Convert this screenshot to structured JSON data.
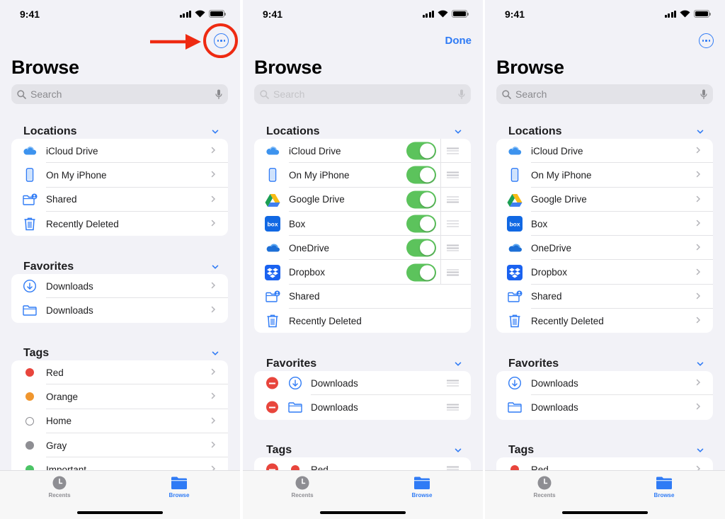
{
  "status": {
    "time": "9:41"
  },
  "colors": {
    "accent": "#2f7bf5",
    "toggle_on": "#5cc35c",
    "delete": "#e8453c",
    "annotation": "#ee2a12"
  },
  "panels": [
    {
      "top_action": {
        "type": "more",
        "icon": "ellipsis-circle-icon"
      },
      "title": "Browse",
      "search_placeholder": "Search",
      "sections": [
        {
          "label": "Locations",
          "rows": [
            {
              "label": "iCloud Drive",
              "icon": "icloud-icon"
            },
            {
              "label": "On My iPhone",
              "icon": "iphone-icon"
            },
            {
              "label": "Shared",
              "icon": "shared-folder-icon"
            },
            {
              "label": "Recently Deleted",
              "icon": "trash-icon"
            }
          ]
        },
        {
          "label": "Favorites",
          "rows": [
            {
              "label": "Downloads",
              "icon": "download-circle-icon"
            },
            {
              "label": "Downloads",
              "icon": "folder-icon"
            }
          ]
        },
        {
          "label": "Tags",
          "rows": [
            {
              "label": "Red",
              "color": "#e8453c"
            },
            {
              "label": "Orange",
              "color": "#f0962e"
            },
            {
              "label": "Home",
              "color": "#ffffff"
            },
            {
              "label": "Gray",
              "color": "#8e8e93"
            },
            {
              "label": "Important",
              "color": "#4cc466"
            }
          ]
        }
      ]
    },
    {
      "top_action": {
        "type": "done",
        "label": "Done"
      },
      "title": "Browse",
      "search_placeholder": "Search",
      "sections": [
        {
          "label": "Locations",
          "rows": [
            {
              "label": "iCloud Drive",
              "icon": "icloud-icon",
              "toggle": true
            },
            {
              "label": "On My iPhone",
              "icon": "iphone-icon",
              "toggle": true
            },
            {
              "label": "Google Drive",
              "icon": "google-drive-icon",
              "toggle": true
            },
            {
              "label": "Box",
              "icon": "box-icon",
              "toggle": true
            },
            {
              "label": "OneDrive",
              "icon": "onedrive-icon",
              "toggle": true
            },
            {
              "label": "Dropbox",
              "icon": "dropbox-icon",
              "toggle": true
            },
            {
              "label": "Shared",
              "icon": "shared-folder-icon"
            },
            {
              "label": "Recently Deleted",
              "icon": "trash-icon"
            }
          ]
        },
        {
          "label": "Favorites",
          "rows": [
            {
              "label": "Downloads",
              "icon": "download-circle-icon"
            },
            {
              "label": "Downloads",
              "icon": "folder-icon"
            }
          ]
        },
        {
          "label": "Tags",
          "rows": [
            {
              "label": "Red",
              "color": "#e8453c"
            }
          ]
        }
      ]
    },
    {
      "top_action": {
        "type": "more",
        "icon": "ellipsis-circle-icon"
      },
      "title": "Browse",
      "search_placeholder": "Search",
      "sections": [
        {
          "label": "Locations",
          "rows": [
            {
              "label": "iCloud Drive",
              "icon": "icloud-icon"
            },
            {
              "label": "On My iPhone",
              "icon": "iphone-icon"
            },
            {
              "label": "Google Drive",
              "icon": "google-drive-icon"
            },
            {
              "label": "Box",
              "icon": "box-icon"
            },
            {
              "label": "OneDrive",
              "icon": "onedrive-icon"
            },
            {
              "label": "Dropbox",
              "icon": "dropbox-icon"
            },
            {
              "label": "Shared",
              "icon": "shared-folder-icon"
            },
            {
              "label": "Recently Deleted",
              "icon": "trash-icon"
            }
          ]
        },
        {
          "label": "Favorites",
          "rows": [
            {
              "label": "Downloads",
              "icon": "download-circle-icon"
            },
            {
              "label": "Downloads",
              "icon": "folder-icon"
            }
          ]
        },
        {
          "label": "Tags",
          "rows": [
            {
              "label": "Red",
              "color": "#e8453c"
            }
          ]
        }
      ]
    }
  ],
  "tabbar": {
    "recents": "Recents",
    "browse": "Browse"
  }
}
